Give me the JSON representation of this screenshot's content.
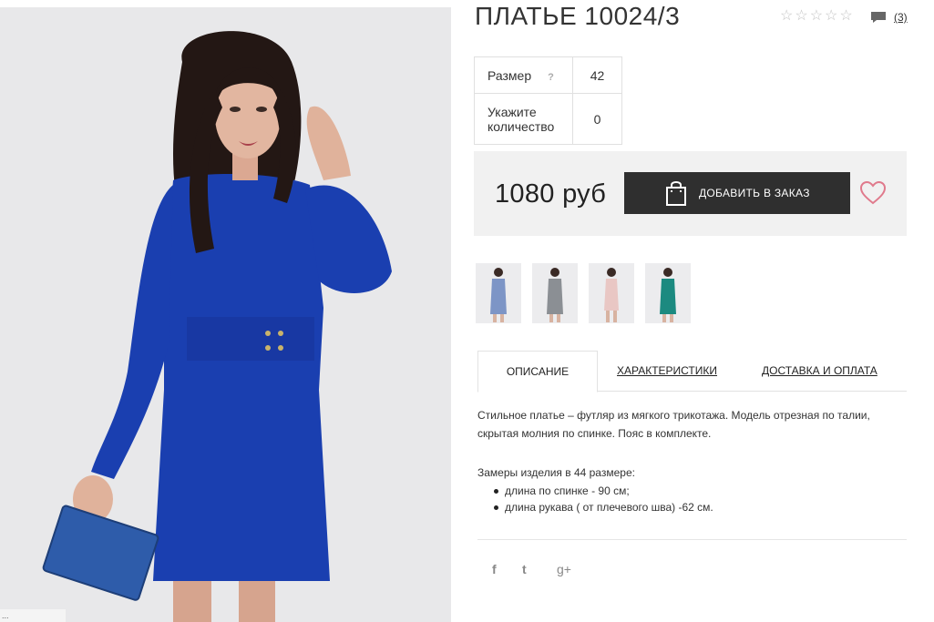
{
  "product": {
    "title": "ПЛАТЬЕ 10024/3",
    "rating_stars": 5,
    "rating_filled": 0,
    "review_count": "(3)"
  },
  "options": {
    "size_label": "Размер",
    "size_help": "?",
    "size_value": "42",
    "qty_label": "Укажите количество",
    "qty_value": "0"
  },
  "buy": {
    "price": "1080 руб",
    "add_button": "ДОБАВИТЬ В ЗАКАЗ"
  },
  "thumbnails": [
    {
      "name": "thumb-light-blue",
      "color": "#7d95c6"
    },
    {
      "name": "thumb-grey",
      "color": "#8b8f94"
    },
    {
      "name": "thumb-pink",
      "color": "#e9c7c4"
    },
    {
      "name": "thumb-teal",
      "color": "#1c8a80"
    }
  ],
  "tabs": {
    "description": "ОПИСАНИЕ",
    "characteristics": "ХАРАКТЕРИСТИКИ",
    "delivery": "ДОСТАВКА И ОПЛАТА"
  },
  "description": {
    "text": "Стильное платье – футляр из мягкого трикотажа. Модель отрезная по талии, скрытая молния по спинке. Пояс в комплекте.",
    "measure_title": "Замеры изделия в 44 размере:",
    "measures": [
      "длина по спинке - 90 см;",
      "длина рукава ( от плечевого шва) -62 см."
    ]
  },
  "social": {
    "facebook": "f",
    "twitter": "t",
    "googleplus": "g+"
  },
  "photo_caption": "...",
  "colors": {
    "dress": "#1a3fb0",
    "button": "#2f2f2f",
    "heart": "#e07a8c"
  }
}
